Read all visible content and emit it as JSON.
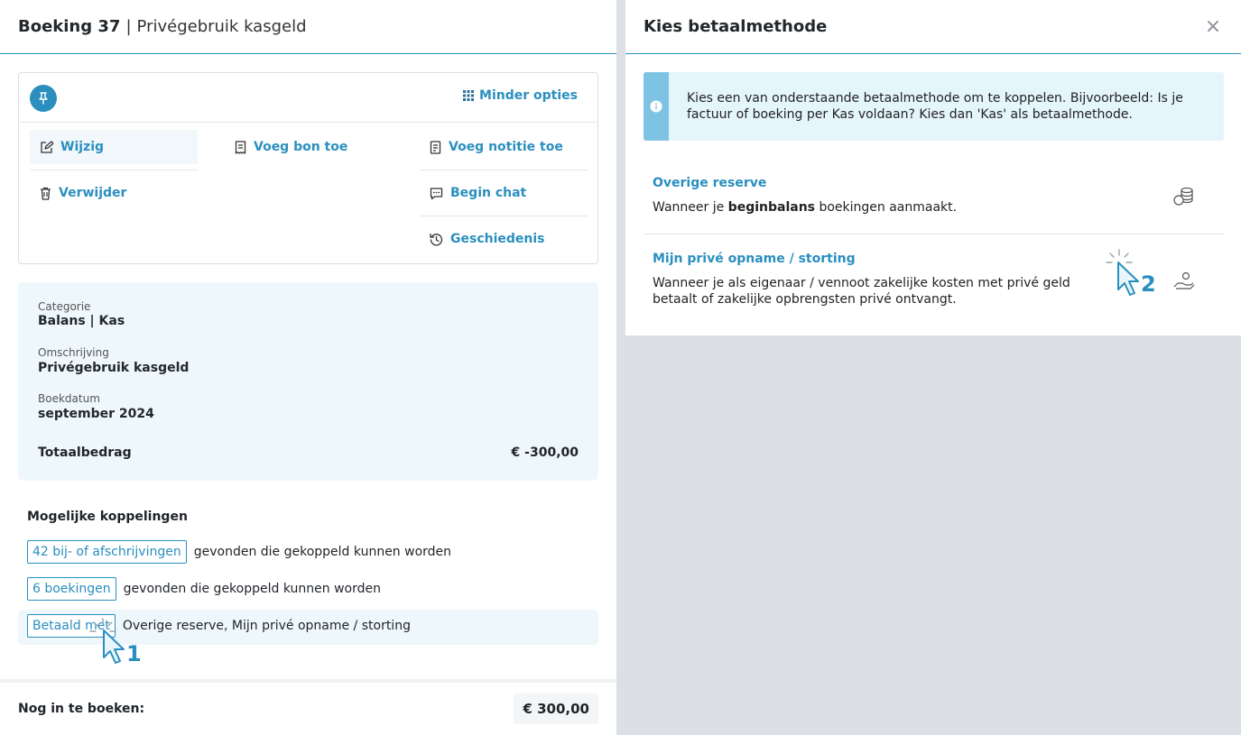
{
  "left": {
    "title_bold": "Boeking 37",
    "separator": "|",
    "title_rest": "Privégebruik kasgeld",
    "options": {
      "minder_label": "Minder opties",
      "items": [
        {
          "label": "Wijzig",
          "icon": "edit-icon"
        },
        {
          "label": "Voeg bon toe",
          "icon": "receipt-icon"
        },
        {
          "label": "Voeg notitie toe",
          "icon": "note-icon"
        },
        {
          "label": "Verwijder",
          "icon": "trash-icon"
        },
        {
          "label": "Begin chat",
          "icon": "chat-icon"
        },
        {
          "label": "Geschiedenis",
          "icon": "history-icon"
        }
      ]
    },
    "details": {
      "categorie_label": "Categorie",
      "categorie_value": "Balans | Kas",
      "omschrijving_label": "Omschrijving",
      "omschrijving_value": "Privégebruik kasgeld",
      "boekdatum_label": "Boekdatum",
      "boekdatum_value": "september 2024",
      "totaal_label": "Totaalbedrag",
      "totaal_value": "€ -300,00"
    },
    "koppelingen": {
      "title": "Mogelijke koppelingen",
      "rows": [
        {
          "button": "42 bij- of afschrijvingen",
          "text": "gevonden die gekoppeld kunnen worden"
        },
        {
          "button": "6 boekingen",
          "text": "gevonden die gekoppeld kunnen worden"
        },
        {
          "button": "Betaald met",
          "text": "Overige reserve, Mijn privé opname / storting"
        }
      ]
    },
    "footer": {
      "label": "Nog in te boeken:",
      "value": "€ 300,00"
    }
  },
  "right": {
    "title": "Kies betaalmethode",
    "close": "×",
    "info_text": "Kies een van onderstaande betaalmethode om te koppelen. Bijvoorbeeld: Is je factuur of boeking per Kas voldaan? Kies dan 'Kas' als betaalmethode.",
    "methods": [
      {
        "title": "Overige reserve",
        "desc_before": "Wanneer je ",
        "desc_bold": "beginbalans",
        "desc_after": " boekingen aanmaakt.",
        "icon": "coins-icon"
      },
      {
        "title": "Mijn privé opname / storting",
        "desc": "Wanneer je als eigenaar / vennoot zakelijke kosten met privé geld betaalt of zakelijke opbrengsten privé ontvangt.",
        "icon": "hand-money-icon"
      }
    ]
  },
  "annotations": {
    "step1": "1",
    "step2": "2"
  },
  "colors": {
    "accent": "#2a8fbf",
    "panel_bg": "#eef7fb",
    "info_bg": "#e5f5fc",
    "backdrop": "#dcdfe5"
  }
}
